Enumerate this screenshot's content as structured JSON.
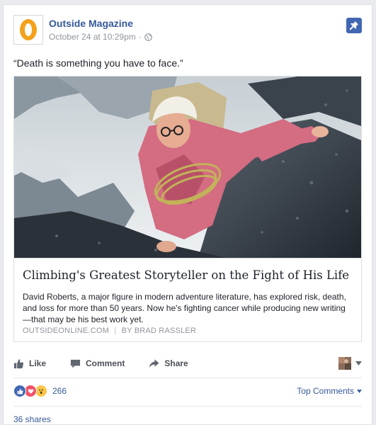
{
  "post": {
    "page_name": "Outside Magazine",
    "timestamp": "October 24 at 10:29pm",
    "separator": "·",
    "audience_icon": "globe-icon",
    "text": "“Death is something you have to face.”",
    "pinned": true
  },
  "link": {
    "headline": "Climbing's Greatest Storyteller on the Fight of His Life",
    "description": "David Roberts, a major figure in modern adventure literature, has explored risk, death, and loss for more than 50 years. Now he's fighting cancer while producing new writing—that may be his best work yet.",
    "source": "OUTSIDEONLINE.COM",
    "source_sep": "|",
    "byline": "BY BRAD RASSLER"
  },
  "actions": {
    "like": "Like",
    "comment": "Comment",
    "share": "Share"
  },
  "reactions": {
    "count": "266",
    "types": [
      "like",
      "love",
      "wow"
    ],
    "sort_label": "Top Comments"
  },
  "shares": "36 shares",
  "colors": {
    "link_blue": "#365899",
    "fb_blue": "#4267b2",
    "love_red": "#f25268",
    "wow_yellow": "#fcc64a",
    "logo_orange": "#f4a21c"
  }
}
